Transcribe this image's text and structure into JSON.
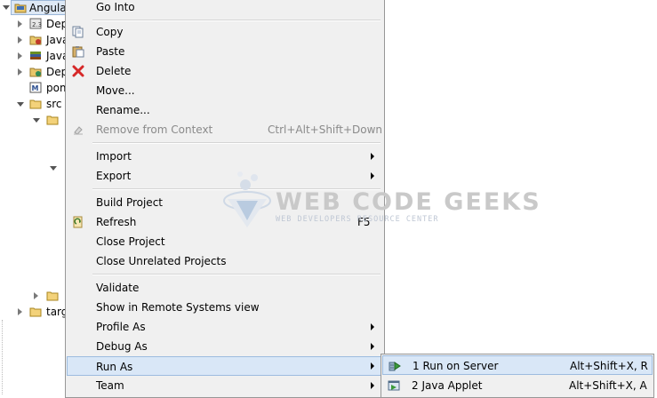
{
  "tree": {
    "items": [
      {
        "label": "Angula",
        "icon": "project-icon"
      },
      {
        "label": "Dep",
        "icon": "dependencies-icon"
      },
      {
        "label": "Java",
        "icon": "java-resources-icon"
      },
      {
        "label": "Java",
        "icon": "java-library-icon"
      },
      {
        "label": "Dep",
        "icon": "deployed-resources-icon"
      },
      {
        "label": "pom",
        "icon": "maven-pom-icon"
      },
      {
        "label": "src",
        "icon": "folder-icon"
      },
      {
        "label": "targ",
        "icon": "folder-icon"
      }
    ]
  },
  "context_menu": {
    "items": [
      {
        "label": "Go Into",
        "accel": "",
        "submenu": false,
        "disabled": false,
        "icon": ""
      },
      {
        "label": "Copy",
        "accel": "",
        "submenu": false,
        "disabled": false,
        "icon": "copy-icon"
      },
      {
        "label": "Paste",
        "accel": "",
        "submenu": false,
        "disabled": false,
        "icon": "paste-icon"
      },
      {
        "label": "Delete",
        "accel": "",
        "submenu": false,
        "disabled": false,
        "icon": "delete-icon"
      },
      {
        "label": "Move...",
        "accel": "",
        "submenu": false,
        "disabled": false,
        "icon": ""
      },
      {
        "label": "Rename...",
        "accel": "",
        "submenu": false,
        "disabled": false,
        "icon": ""
      },
      {
        "label": "Remove from Context",
        "accel": "Ctrl+Alt+Shift+Down",
        "submenu": false,
        "disabled": true,
        "icon": "remove-context-icon"
      },
      {
        "label": "Import",
        "accel": "",
        "submenu": true,
        "disabled": false,
        "icon": ""
      },
      {
        "label": "Export",
        "accel": "",
        "submenu": true,
        "disabled": false,
        "icon": ""
      },
      {
        "label": "Build Project",
        "accel": "",
        "submenu": false,
        "disabled": false,
        "icon": ""
      },
      {
        "label": "Refresh",
        "accel": "F5",
        "submenu": false,
        "disabled": false,
        "icon": "refresh-icon"
      },
      {
        "label": "Close Project",
        "accel": "",
        "submenu": false,
        "disabled": false,
        "icon": ""
      },
      {
        "label": "Close Unrelated Projects",
        "accel": "",
        "submenu": false,
        "disabled": false,
        "icon": ""
      },
      {
        "label": "Validate",
        "accel": "",
        "submenu": false,
        "disabled": false,
        "icon": ""
      },
      {
        "label": "Show in Remote Systems view",
        "accel": "",
        "submenu": false,
        "disabled": false,
        "icon": ""
      },
      {
        "label": "Profile As",
        "accel": "",
        "submenu": true,
        "disabled": false,
        "icon": ""
      },
      {
        "label": "Debug As",
        "accel": "",
        "submenu": true,
        "disabled": false,
        "icon": ""
      },
      {
        "label": "Run As",
        "accel": "",
        "submenu": true,
        "disabled": false,
        "icon": "",
        "highlighted": true
      },
      {
        "label": "Team",
        "accel": "",
        "submenu": true,
        "disabled": false,
        "icon": ""
      }
    ]
  },
  "run_as_submenu": {
    "items": [
      {
        "label": "1 Run on Server",
        "accel": "Alt+Shift+X, R",
        "icon": "run-on-server-icon",
        "highlighted": true
      },
      {
        "label": "2 Java Applet",
        "accel": "Alt+Shift+X, A",
        "icon": "java-applet-icon"
      }
    ]
  },
  "watermark": {
    "title": "WEB CODE GEEKS",
    "subtitle": "WEB DEVELOPERS RESOURCE CENTER"
  },
  "colors": {
    "menu_bg": "#f0f0f0",
    "highlight_bg": "#d9e7f7",
    "highlight_border": "#9dbcdf",
    "delete_red": "#d62828"
  }
}
